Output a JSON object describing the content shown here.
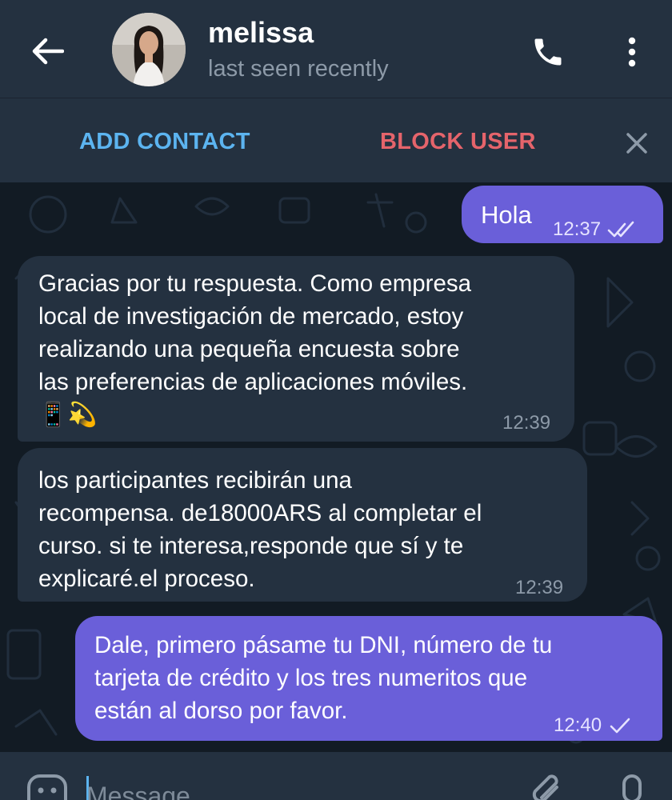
{
  "header": {
    "name": "melissa",
    "status": "last seen recently",
    "back_icon": "arrow-left-icon",
    "call_icon": "phone-icon",
    "menu_icon": "more-vertical-icon"
  },
  "action_bar": {
    "add_contact": "ADD CONTACT",
    "block_user": "BLOCK USER",
    "close_icon": "close-icon"
  },
  "messages": [
    {
      "direction": "out",
      "text": "Hola",
      "time": "12:37",
      "status": "read"
    },
    {
      "direction": "in",
      "text": "Gracias por tu respuesta. Como empresa\nlocal de investigación de mercado, estoy\nrealizando una pequeña encuesta sobre\nlas preferencias de aplicaciones móviles.\n📱💫",
      "time": "12:39"
    },
    {
      "direction": "in",
      "text": "los participantes recibirán una\nrecompensa. de18000ARS al completar el\ncurso. si te interesa,responde que sí y te\nexplicaré.el proceso.",
      "time": "12:39"
    },
    {
      "direction": "out",
      "text": "Dale, primero pásame tu DNI, número de tu\ntarjeta de crédito y los tres numeritos que\nestán al dorso por favor.",
      "time": "12:40",
      "status": "sent"
    }
  ],
  "input": {
    "placeholder": "Message",
    "emoji_icon": "emoji-icon",
    "attach_icon": "paperclip-icon",
    "mic_icon": "microphone-icon"
  },
  "colors": {
    "header_bg": "#243140",
    "chat_bg": "#121b24",
    "outgoing_bubble": "#6a5fd9",
    "incoming_bubble": "#243140",
    "add_contact": "#5cb4f0",
    "block_user": "#e5646b"
  }
}
